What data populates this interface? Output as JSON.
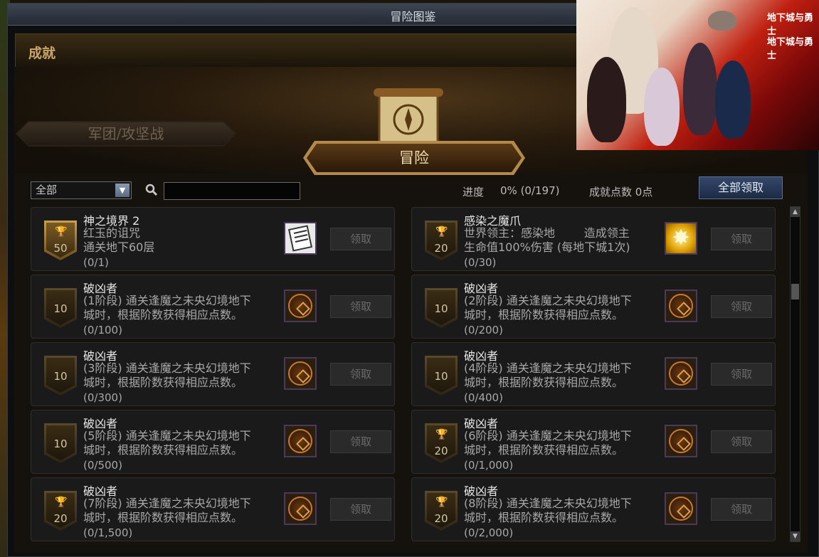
{
  "window": {
    "title": "冒险图鉴"
  },
  "section": {
    "title": "成就"
  },
  "tabs": {
    "legion": "军团/攻坚战",
    "adventure": "冒险"
  },
  "filter": {
    "selected": "全部"
  },
  "search": {
    "value": ""
  },
  "progress": {
    "label": "进度",
    "value": "0%  (0/197)"
  },
  "points": {
    "text": "成就点数 0点"
  },
  "claim_all_label": "全部领取",
  "claim_label": "领取",
  "artwork": {
    "logo_text": "地下城与勇士"
  },
  "achievements": [
    {
      "name": "神之境界 2",
      "desc": "红玉的诅咒\n通关地下60层",
      "progress": "(0/1)",
      "points": "50",
      "badge": "gold-trophy",
      "reward_icon": "scroll-icon"
    },
    {
      "name": "感染之魔爪",
      "desc": "世界领主：感染地        造成领主\n生命值100%伤害 (每地下城1次)",
      "progress": "(0/30)",
      "points": "20",
      "badge": "silver-trophy",
      "reward_icon": "star-icon"
    },
    {
      "name": "破凶者",
      "desc": "(1阶段) 通关逢魔之未央幻境地下\n城时，根据阶数获得相应点数。",
      "progress": "(0/100)",
      "points": "10",
      "badge": "plain",
      "reward_icon": "emblem-icon"
    },
    {
      "name": "破凶者",
      "desc": "(2阶段) 通关逢魔之未央幻境地下\n城时，根据阶数获得相应点数。",
      "progress": "(0/200)",
      "points": "10",
      "badge": "plain",
      "reward_icon": "emblem-icon"
    },
    {
      "name": "破凶者",
      "desc": "(3阶段) 通关逢魔之未央幻境地下\n城时，根据阶数获得相应点数。",
      "progress": "(0/300)",
      "points": "10",
      "badge": "plain",
      "reward_icon": "emblem-icon"
    },
    {
      "name": "破凶者",
      "desc": "(4阶段) 通关逢魔之未央幻境地下\n城时，根据阶数获得相应点数。",
      "progress": "(0/400)",
      "points": "10",
      "badge": "plain",
      "reward_icon": "emblem-icon"
    },
    {
      "name": "破凶者",
      "desc": "(5阶段) 通关逢魔之未央幻境地下\n城时，根据阶数获得相应点数。",
      "progress": "(0/500)",
      "points": "10",
      "badge": "plain",
      "reward_icon": "emblem-icon"
    },
    {
      "name": "破凶者",
      "desc": "(6阶段) 通关逢魔之未央幻境地下\n城时，根据阶数获得相应点数。",
      "progress": "(0/1,000)",
      "points": "20",
      "badge": "silver-trophy",
      "reward_icon": "emblem-icon"
    },
    {
      "name": "破凶者",
      "desc": "(7阶段) 通关逢魔之未央幻境地下\n城时，根据阶数获得相应点数。",
      "progress": "(0/1,500)",
      "points": "20",
      "badge": "silver-trophy",
      "reward_icon": "emblem-icon"
    },
    {
      "name": "破凶者",
      "desc": "(8阶段) 通关逢魔之未央幻境地下\n城时，根据阶数获得相应点数。",
      "progress": "(0/2,000)",
      "points": "20",
      "badge": "silver-trophy",
      "reward_icon": "emblem-icon"
    }
  ]
}
